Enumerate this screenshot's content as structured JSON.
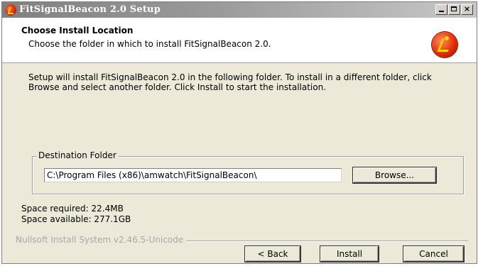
{
  "window": {
    "title": "FitSignalBeacon 2.0 Setup",
    "icon": "installer-icon",
    "controls": {
      "minimize": "minimize-icon",
      "maximize": "maximize-icon",
      "close_label": "×"
    }
  },
  "header": {
    "title": "Choose Install Location",
    "subtitle": "Choose the folder in which to install FitSignalBeacon 2.0.",
    "logo": "app-logo-icon"
  },
  "body": {
    "intro": "Setup will install FitSignalBeacon 2.0 in the following folder. To install in a different folder, click Browse and select another folder. Click Install to start the installation.",
    "destination": {
      "legend": "Destination Folder",
      "path": "C:\\Program Files (x86)\\amwatch\\FitSignalBeacon\\",
      "browse_label": "Browse..."
    },
    "space_required": "Space required: 22.4MB",
    "space_available": "Space available: 277.1GB"
  },
  "footer": {
    "branding": "Nullsoft Install System v2.46.5-Unicode",
    "back_label": "< Back",
    "install_label": "Install",
    "cancel_label": "Cancel"
  },
  "colors": {
    "dialog_bg": "#ece9d8",
    "titlebar_start": "#808080",
    "titlebar_end": "#c8c8c8",
    "logo_red": "#e02800",
    "logo_yellow": "#ffd400"
  }
}
